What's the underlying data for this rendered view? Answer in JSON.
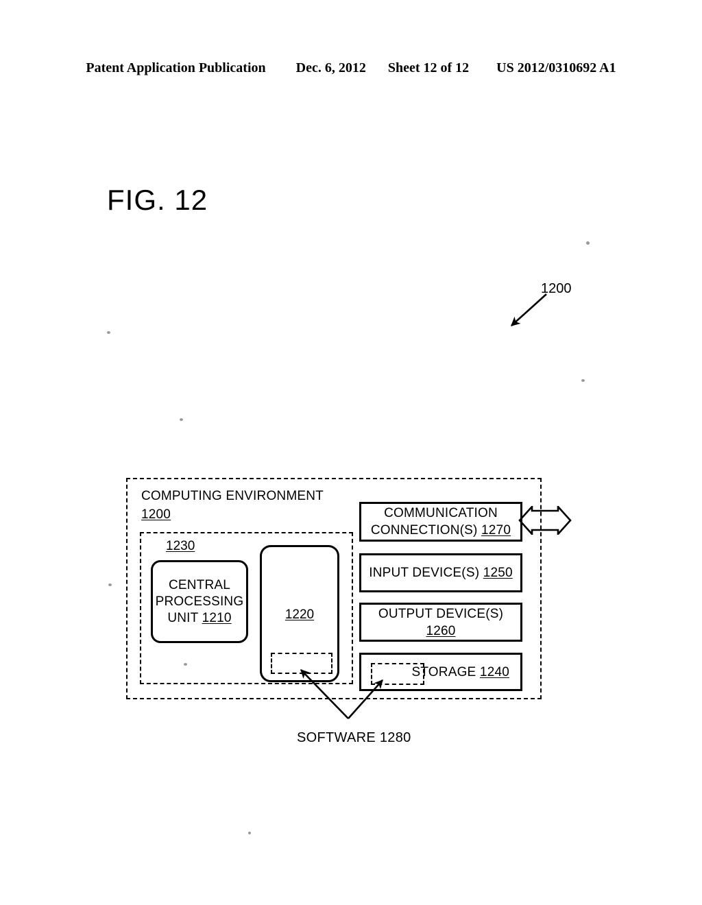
{
  "header": {
    "publication": "Patent Application Publication",
    "date": "Dec. 6, 2012",
    "sheet": "Sheet 12 of 12",
    "patent_number": "US 2012/0310692 A1"
  },
  "figure": {
    "title": "FIG. 12",
    "callout_ref": "1200"
  },
  "diagram": {
    "computing_environment": {
      "label": "COMPUTING ENVIRONMENT",
      "ref": "1200"
    },
    "processing_group": {
      "ref": "1230"
    },
    "cpu": {
      "line1": "CENTRAL",
      "line2": "PROCESSING",
      "line3": "UNIT ",
      "ref": "1210"
    },
    "memory": {
      "ref": "1220"
    },
    "communication": {
      "line1": "COMMUNICATION",
      "line2": "CONNECTION(S) ",
      "ref": "1270"
    },
    "input_devices": {
      "label": "INPUT DEVICE(S) ",
      "ref": "1250"
    },
    "output_devices": {
      "line1": "OUTPUT DEVICE(S)",
      "ref": "1260"
    },
    "storage": {
      "label": "STORAGE ",
      "ref": "1240"
    },
    "software": {
      "label": "SOFTWARE 1280"
    }
  }
}
